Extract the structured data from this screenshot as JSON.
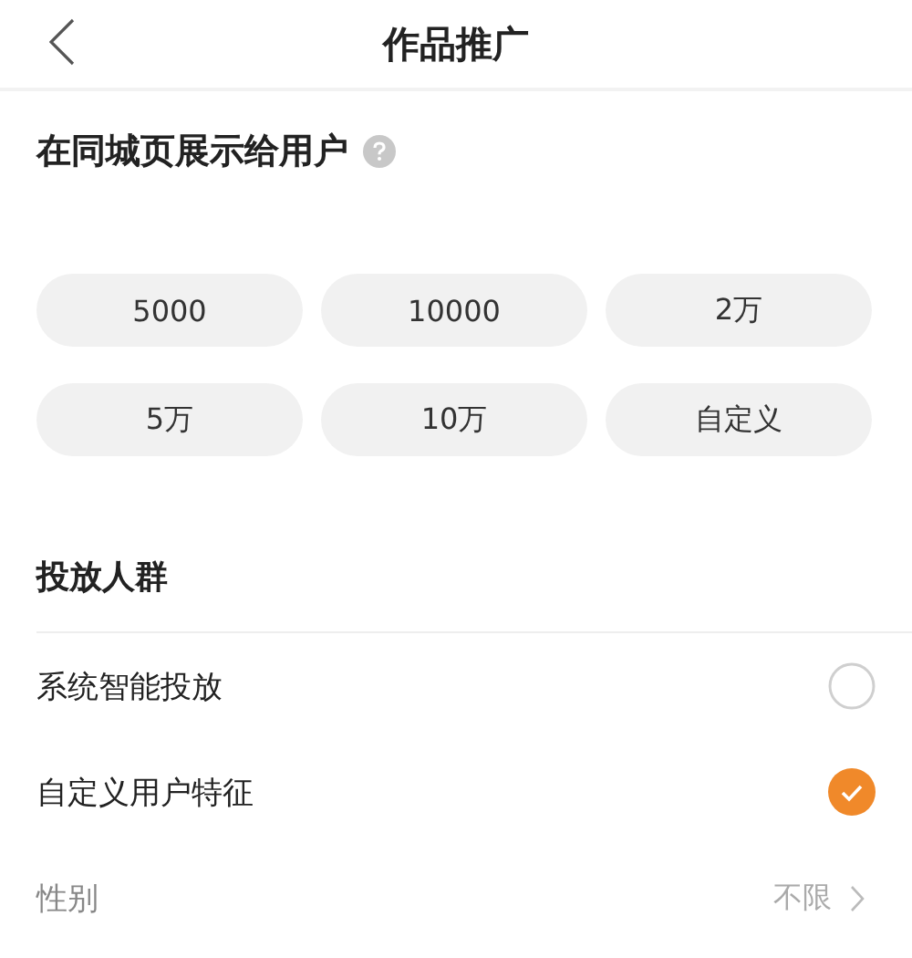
{
  "header": {
    "title": "作品推广"
  },
  "exposure": {
    "title": "在同城页展示给用户",
    "options": [
      {
        "label": "5000"
      },
      {
        "label": "10000"
      },
      {
        "label": "2万"
      },
      {
        "label": "5万"
      },
      {
        "label": "10万"
      },
      {
        "label": "自定义"
      }
    ]
  },
  "audience": {
    "title": "投放人群",
    "items": [
      {
        "kind": "radio",
        "label": "系统智能投放",
        "selected": false
      },
      {
        "kind": "radio",
        "label": "自定义用户特征",
        "selected": true
      },
      {
        "kind": "setting",
        "label": "性别",
        "value": "不限"
      }
    ]
  }
}
